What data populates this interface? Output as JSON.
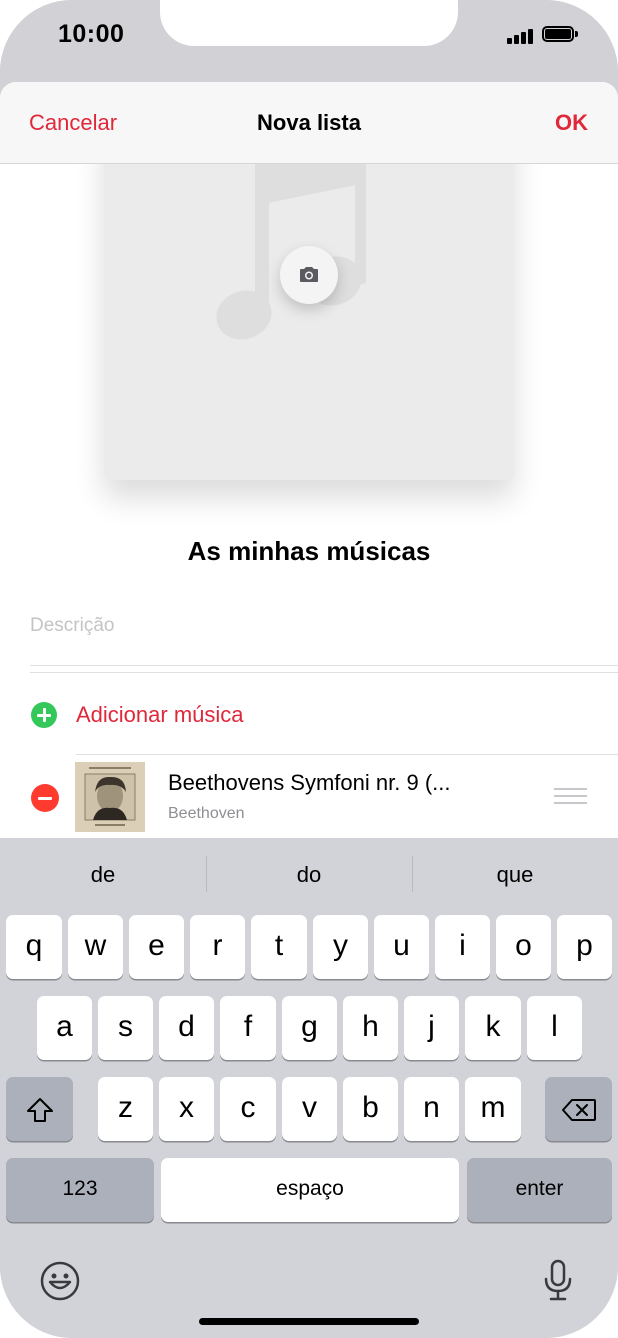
{
  "status_bar": {
    "time": "10:00",
    "signal_icon": "cellular-signal-icon",
    "battery_icon": "battery-icon"
  },
  "nav": {
    "cancel_label": "Cancelar",
    "title": "Nova lista",
    "ok_label": "OK"
  },
  "artwork": {
    "placeholder_icon": "music-note-icon",
    "camera_icon": "camera-icon"
  },
  "playlist": {
    "name": "As minhas músicas",
    "description_placeholder": "Descrição",
    "add_music_label": "Adicionar música"
  },
  "songs": [
    {
      "title": "Beethovens Symfoni nr. 9 (...",
      "artist": "Beethoven"
    }
  ],
  "keyboard": {
    "suggestions": [
      "de",
      "do",
      "que"
    ],
    "rows": [
      [
        "q",
        "w",
        "e",
        "r",
        "t",
        "y",
        "u",
        "i",
        "o",
        "p"
      ],
      [
        "a",
        "s",
        "d",
        "f",
        "g",
        "h",
        "j",
        "k",
        "l"
      ],
      [
        "z",
        "x",
        "c",
        "v",
        "b",
        "n",
        "m"
      ]
    ],
    "numbers_label": "123",
    "space_label": "espaço",
    "enter_label": "enter"
  },
  "colors": {
    "accent": "#e0283b",
    "add_green": "#34c759",
    "remove_red": "#ff3b30",
    "keyboard_bg": "#d1d3d9"
  }
}
